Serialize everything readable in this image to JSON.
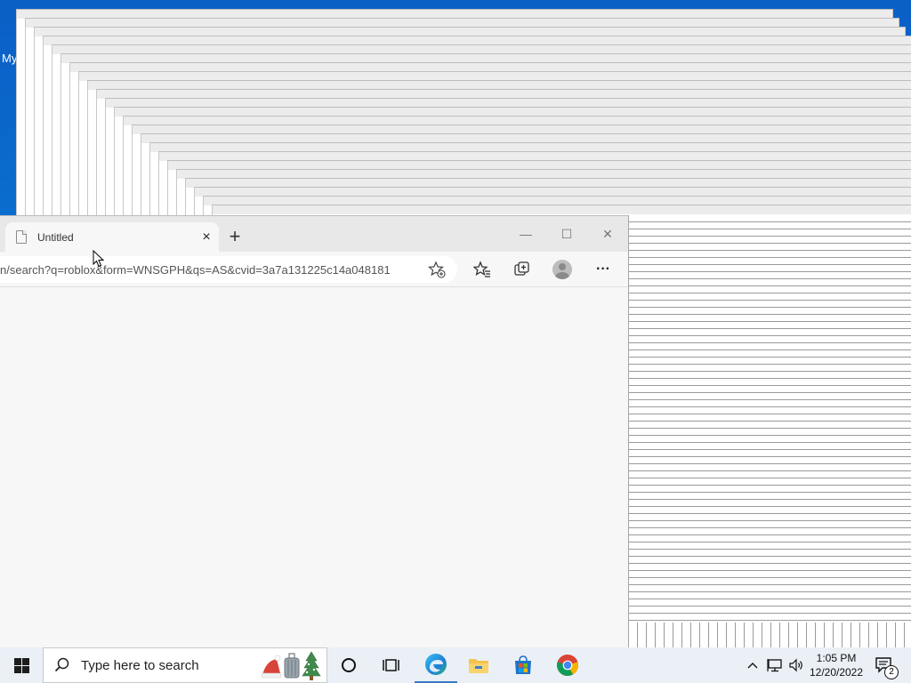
{
  "desktop": {
    "icon_label_partial": "My"
  },
  "browser": {
    "tab_title": "Untitled",
    "tab_close": "×",
    "new_tab": "+",
    "minimize": "—",
    "maximize": "☐",
    "close": "✕",
    "address": "n/search?q=roblox&form=WNSGPH&qs=AS&cvid=3a7a131225c14a048181",
    "more": "···"
  },
  "taskbar": {
    "search_placeholder": "Type here to search",
    "clock_time": "1:05 PM",
    "clock_date": "12/20/2022",
    "notification_count": "2"
  },
  "icons": [
    "windows-start-icon",
    "search-icon",
    "cortana-icon",
    "task-view-icon",
    "edge-icon",
    "file-explorer-icon",
    "store-icon",
    "chrome-icon",
    "tray-chevron-icon",
    "network-icon",
    "volume-icon",
    "notification-icon"
  ],
  "colors": {
    "desktop_blue": "#0a78d4",
    "taskbar": "#eaf0f6",
    "browser_bg": "#f7f7f7"
  }
}
